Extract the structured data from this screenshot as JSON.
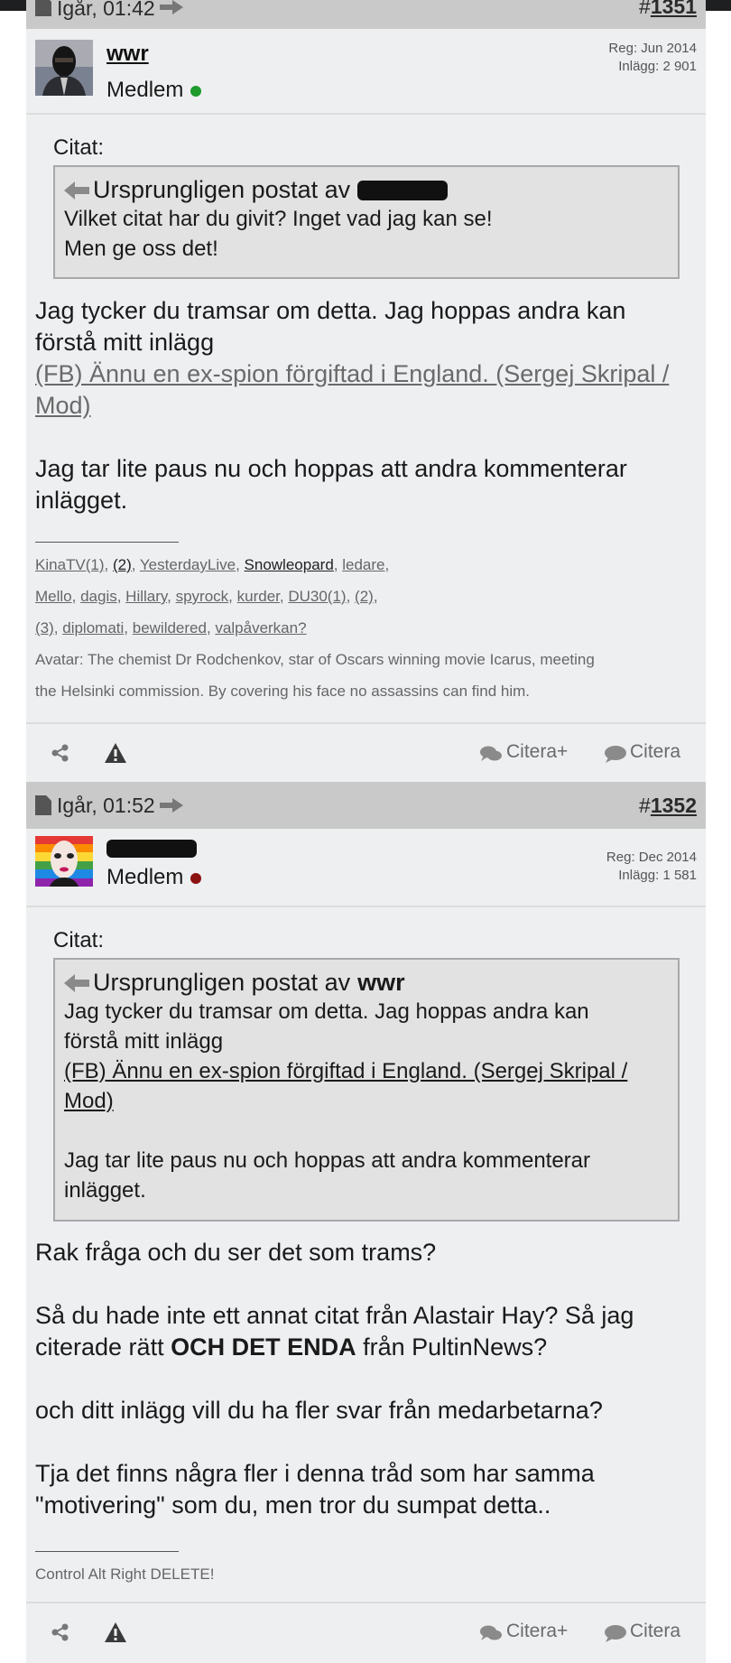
{
  "post1": {
    "header_date": "Igår, 01:42",
    "header_num_prefix": "#",
    "header_num": "1351",
    "username": "wwr",
    "role": "Medlem",
    "status_color": "#1f9a2c",
    "reg": "Reg: Jun 2014",
    "posts": "Inlägg: 2 901",
    "citat_label": "Citat:",
    "quote_prefix": "Ursprungligen postat av",
    "quote_lines": [
      "Vilket citat har du givit? Inget vad jag kan se!",
      "Men ge oss det!"
    ],
    "body_line1": "Jag tycker du tramsar om detta. Jag hoppas andra kan",
    "body_line2": "förstå mitt inlägg",
    "body_link1": "(FB) Ännu en ex-spion förgiftad i England. (Sergej Skripal /",
    "body_link2": "Mod)",
    "body_line3": "Jag tar lite paus nu och hoppas att andra kommenterar",
    "body_line4": "inlägget.",
    "sig_links": [
      "KinaTV(1)",
      "(2)",
      "YesterdayLive",
      "Snowleopard",
      "ledare",
      "Mello",
      "dagis",
      "Hillary",
      "spyrock",
      "kurder",
      "DU30(1)",
      "(2)",
      "(3)",
      "diplomati",
      "bewildered",
      "valpåverkan?"
    ],
    "sig_avatar1": "Avatar: The chemist Dr Rodchenkov, star of Oscars winning movie Icarus, meeting",
    "sig_avatar2": "the Helsinki commission. By covering his face no assassins can find him.",
    "citera_plus": "Citera+",
    "citera": "Citera"
  },
  "post2": {
    "header_date": "Igår, 01:52",
    "header_num_prefix": "#",
    "header_num": "1352",
    "role": "Medlem",
    "status_color": "#8b1010",
    "reg": "Reg: Dec 2014",
    "posts": "Inlägg: 1 581",
    "citat_label": "Citat:",
    "quote_prefix": "Ursprungligen postat av",
    "quote_author": "wwr",
    "quote_line1": "Jag tycker du tramsar om detta. Jag hoppas andra kan",
    "quote_line2": "förstå mitt inlägg",
    "quote_link1": "(FB) Ännu en ex-spion förgiftad i England. (Sergej Skripal /",
    "quote_link2": "Mod)",
    "quote_line3": "Jag tar lite paus nu och hoppas att andra kommenterar",
    "quote_line4": "inlägget.",
    "body_p1": "Rak fråga och du ser det som trams?",
    "body_p2a": "Så du hade inte ett annat citat från Alastair Hay? Så jag",
    "body_p2b_pre": "citerade rätt ",
    "body_p2b_bold": "OCH DET ENDA",
    "body_p2b_post": " från PultinNews?",
    "body_p3": "och ditt inlägg vill du ha fler svar från medarbetarna?",
    "body_p4a": "Tja det finns några fler i denna tråd som har samma",
    "body_p4b": "\"motivering\" som du, men tror du sumpat detta..",
    "sig": "Control Alt Right DELETE!",
    "citera_plus": "Citera+",
    "citera": "Citera"
  },
  "icons": {
    "share": "share-icon",
    "report": "warning-icon",
    "quote_plus": "speech-bubbles-icon",
    "quote": "speech-bubble-icon"
  }
}
